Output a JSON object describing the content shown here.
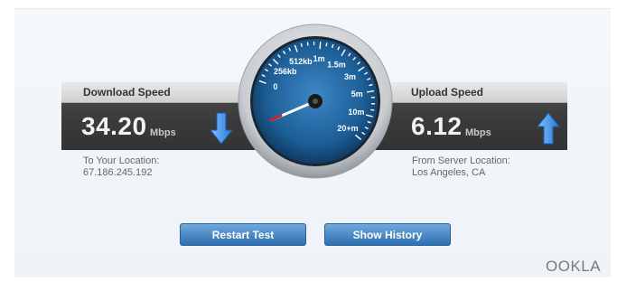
{
  "download": {
    "label": "Download Speed",
    "value": "34.20",
    "unit": "Mbps",
    "location_label": "To Your Location:",
    "location_value": "67.186.245.192"
  },
  "upload": {
    "label": "Upload Speed",
    "value": "6.12",
    "unit": "Mbps",
    "location_label": "From Server Location:",
    "location_value": "Los Angeles, CA"
  },
  "gauge": {
    "ticks": [
      "0",
      "256kb",
      "512kb",
      "1m",
      "1.5m",
      "3m",
      "5m",
      "10m",
      "20+m"
    ]
  },
  "buttons": {
    "restart": "Restart Test",
    "history": "Show History"
  },
  "logo": "OOKLA",
  "colors": {
    "button": "#3a7fc4",
    "arrow": "#3b8be0",
    "needle": "#ffffff",
    "needle_tip": "#d22020",
    "gauge_face": "#1d5f97"
  }
}
